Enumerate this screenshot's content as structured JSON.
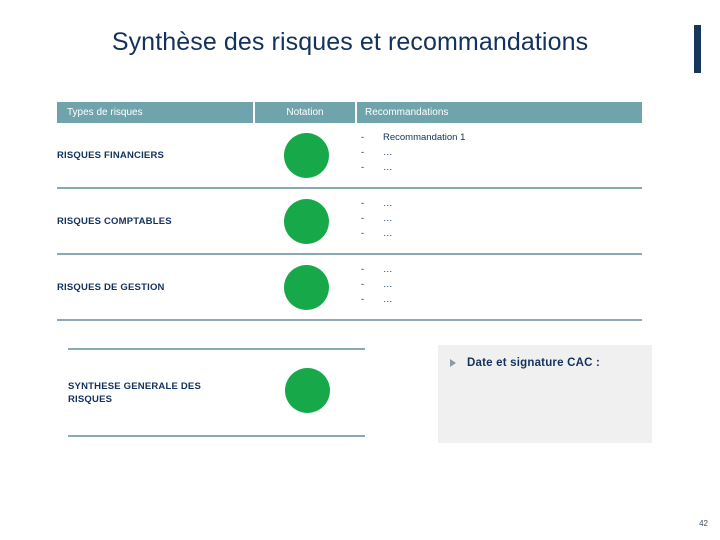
{
  "slide": {
    "title": "Synthèse des risques et recommandations",
    "page_number": "42",
    "accent_color": "#16365e",
    "header_color": "#6fa4ac",
    "rule_color": "#89aab0",
    "rating_dot_color": "#17a84a",
    "text_color": "#12315c"
  },
  "table": {
    "headers": {
      "types": "Types de risques",
      "notation": "Notation",
      "recommandations": "Recommandations"
    },
    "rows": [
      {
        "type": "RISQUES FINANCIERS",
        "notation_icon": "green-circle",
        "recommendations": [
          {
            "dash": "-",
            "text": "Recommandation 1"
          },
          {
            "dash": "-",
            "text": "…"
          },
          {
            "dash": "-",
            "text": "…"
          }
        ]
      },
      {
        "type": "RISQUES COMPTABLES",
        "notation_icon": "green-circle",
        "recommendations": [
          {
            "dash": "-",
            "text": "…"
          },
          {
            "dash": "-",
            "text": "…"
          },
          {
            "dash": "-",
            "text": "…"
          }
        ]
      },
      {
        "type": "RISQUES DE GESTION",
        "notation_icon": "green-circle",
        "recommendations": [
          {
            "dash": "-",
            "text": "…"
          },
          {
            "dash": "-",
            "text": "…"
          },
          {
            "dash": "-",
            "text": "…"
          }
        ]
      }
    ]
  },
  "synthesis": {
    "label_line1": "SYNTHESE GENERALE DES",
    "label_line2": "RISQUES",
    "notation_icon": "green-circle"
  },
  "signature": {
    "bullet_icon": "triangle-right-bullet",
    "label": "Date et signature CAC :"
  }
}
